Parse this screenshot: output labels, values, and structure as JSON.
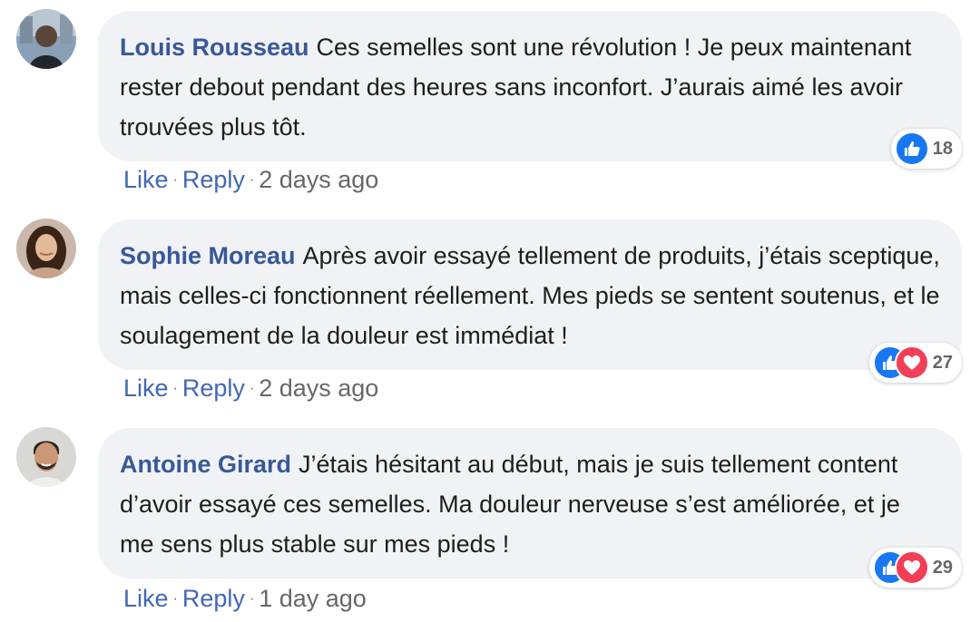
{
  "comments": [
    {
      "author": "Louis Rousseau",
      "text": "Ces semelles sont une révolution ! Je peux maintenant rester debout pendant des heures sans inconfort. J’aurais aimé les avoir trouvées plus tôt.",
      "reaction_count": "18",
      "reactions": [
        "like-icon"
      ],
      "like_label": "Like",
      "reply_label": "Reply",
      "separator": "·",
      "time": "2 days ago"
    },
    {
      "author": "Sophie Moreau",
      "text": "Après avoir essayé tellement de produits, j’étais sceptique, mais celles-ci fonctionnent réellement. Mes pieds se sentent soutenus, et le soulagement de la douleur est immédiat !",
      "reaction_count": "27",
      "reactions": [
        "like-icon",
        "love-icon"
      ],
      "like_label": "Like",
      "reply_label": "Reply",
      "separator": "·",
      "time": "2 days ago"
    },
    {
      "author": "Antoine Girard",
      "text": "J’étais hésitant au début, mais je suis tellement content d’avoir essayé ces semelles. Ma douleur nerveuse s’est améliorée, et je me sens plus stable sur mes pieds !",
      "reaction_count": "29",
      "reactions": [
        "like-icon",
        "love-icon"
      ],
      "like_label": "Like",
      "reply_label": "Reply",
      "separator": "·",
      "time": "1 day ago"
    }
  ],
  "colors": {
    "author": "#385898",
    "link": "#4267b2",
    "bubble": "#f0f2f5",
    "like": "#1877f2",
    "love": "#f33e58",
    "meta": "#65676b"
  }
}
